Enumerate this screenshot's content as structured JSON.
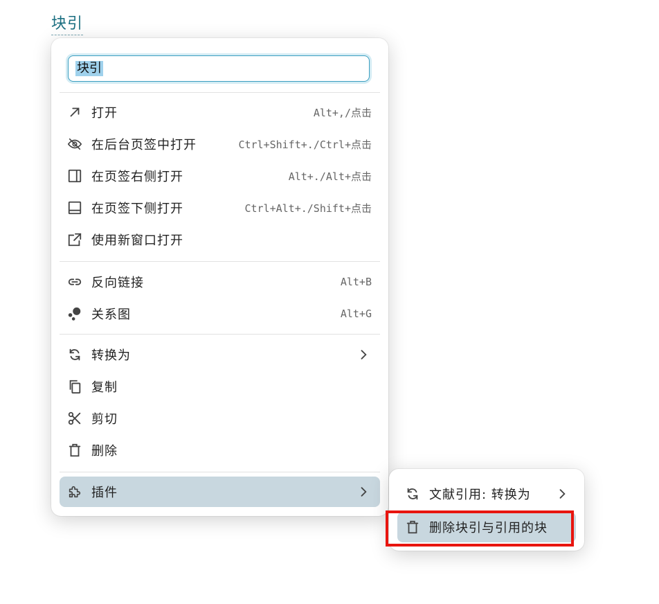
{
  "ref_title": "块引",
  "input": {
    "value": "块引"
  },
  "groups": [
    [
      {
        "icon": "arrow-up-right-icon",
        "label": "打开",
        "shortcut": "Alt+,/点击"
      },
      {
        "icon": "eye-off-icon",
        "label": "在后台页签中打开",
        "shortcut": "Ctrl+Shift+./Ctrl+点击"
      },
      {
        "icon": "layout-right-icon",
        "label": "在页签右侧打开",
        "shortcut": "Alt+./Alt+点击"
      },
      {
        "icon": "layout-bottom-icon",
        "label": "在页签下侧打开",
        "shortcut": "Ctrl+Alt+./Shift+点击"
      },
      {
        "icon": "open-window-icon",
        "label": "使用新窗口打开",
        "shortcut": ""
      }
    ],
    [
      {
        "icon": "link-icon",
        "label": "反向链接",
        "shortcut": "Alt+B"
      },
      {
        "icon": "graph-icon",
        "label": "关系图",
        "shortcut": "Alt+G"
      }
    ],
    [
      {
        "icon": "refresh-icon",
        "label": "转换为",
        "shortcut": ""
      },
      {
        "icon": "copy-icon",
        "label": "复制",
        "shortcut": ""
      },
      {
        "icon": "scissors-icon",
        "label": "剪切",
        "shortcut": ""
      },
      {
        "icon": "trash-icon",
        "label": "删除",
        "shortcut": ""
      }
    ],
    [
      {
        "icon": "puzzle-icon",
        "label": "插件",
        "shortcut": ""
      }
    ]
  ],
  "submenu": [
    {
      "icon": "refresh-icon",
      "label": "文献引用: 转换为"
    },
    {
      "icon": "trash-icon",
      "label": "删除块引与引用的块"
    }
  ],
  "colors": {
    "accent": "#1a6e80",
    "active_bg": "#c8d7df",
    "highlight": "#e8150f",
    "input_border": "#3b9ec0"
  }
}
